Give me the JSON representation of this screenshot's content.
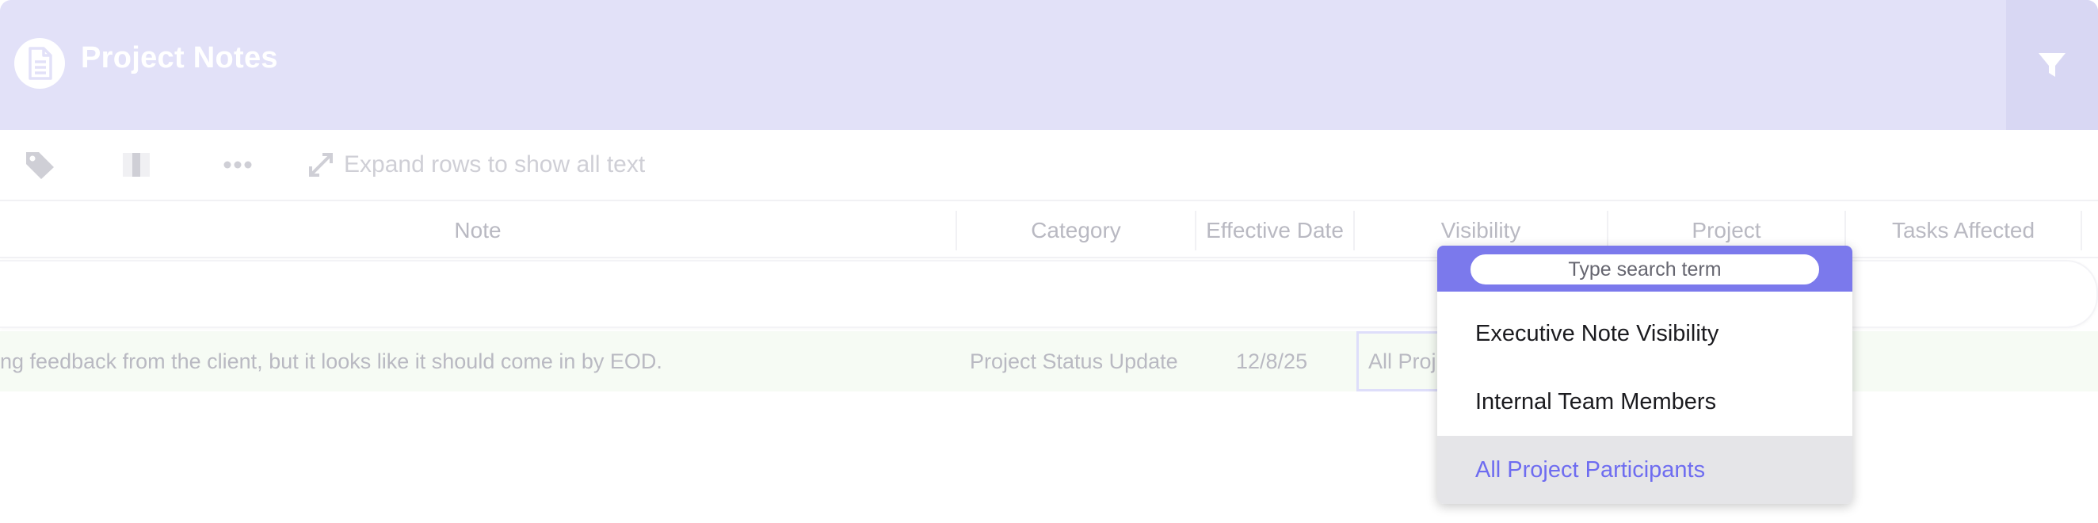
{
  "header": {
    "title": "Project Notes",
    "icon": "document-icon",
    "filter_icon": "filter-icon",
    "background_color": "#e2e1f8"
  },
  "toolbar": {
    "tag_icon": "tag-icon",
    "columns_icon": "columns-icon",
    "more_icon": "more-icon",
    "expand_icon": "expand-icon",
    "expand_label": "Expand rows to show all text"
  },
  "columns": {
    "note": "Note",
    "category": "Category",
    "effective_date": "Effective Date",
    "visibility": "Visibility",
    "project": "Project",
    "tasks_affected": "Tasks Affected"
  },
  "row": {
    "note": "ng feedback from the client, but it looks like it should come in by EOD.",
    "category": "Project Status Update",
    "effective_date": "12/8/25",
    "visibility": "All Proj"
  },
  "dropdown": {
    "search_placeholder": "Type search term",
    "options": [
      {
        "label": "Executive Note Visibility",
        "selected": false
      },
      {
        "label": "Internal Team Members",
        "selected": false
      },
      {
        "label": "All Project Participants",
        "selected": true
      }
    ],
    "accent_color": "#7b79ec"
  }
}
